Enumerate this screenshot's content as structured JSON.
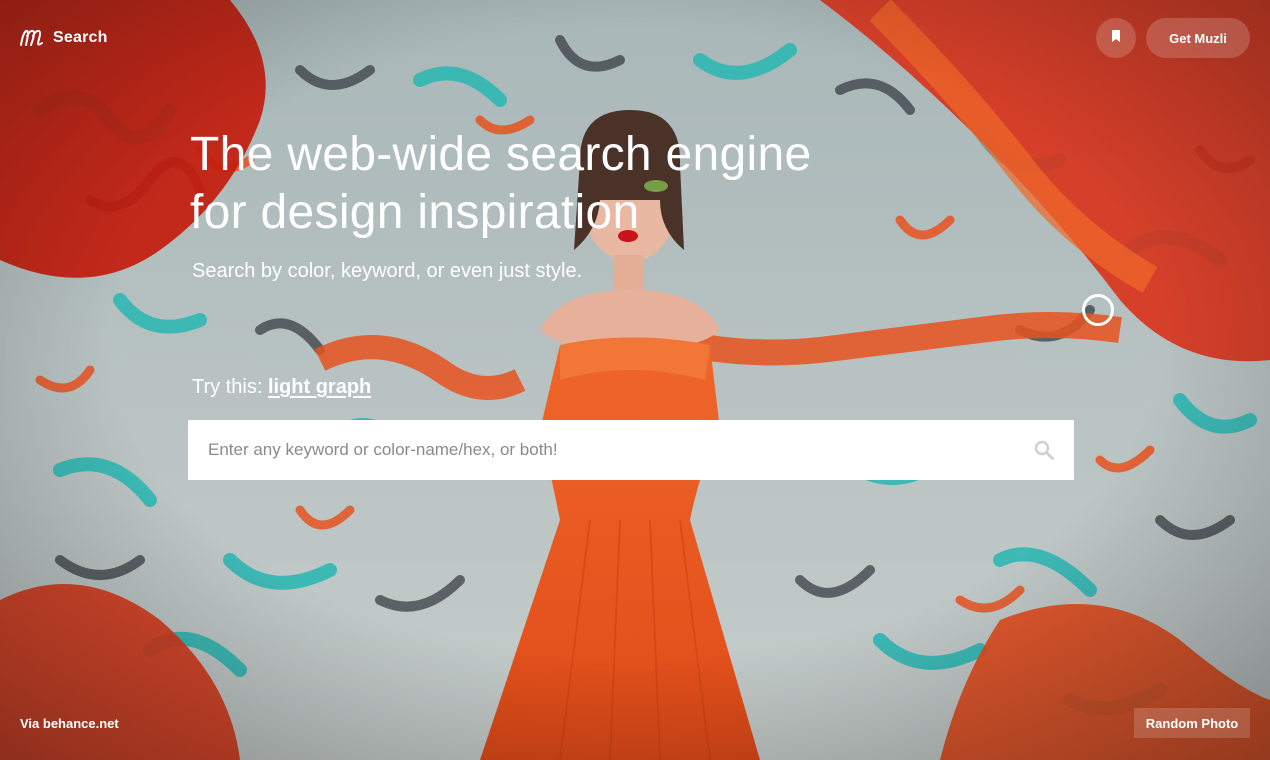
{
  "colors": {
    "accent_orange": "#e8521e",
    "paint_teal": "#2fb8b4",
    "paint_dark": "#3a3f46",
    "wall": "#b9c4c4",
    "text": "#ffffff",
    "search_bg": "#ffffff",
    "placeholder": "#8a8a8a"
  },
  "header": {
    "logo_icon": "muzli-m-logo-icon",
    "title": "Search",
    "bookmark_icon": "bookmark-icon",
    "get_button": "Get Muzli"
  },
  "hero": {
    "title_line1": "The web-wide search engine",
    "title_line2": "for design inspiration",
    "subtitle": "Search by color, keyword, or even just style."
  },
  "try": {
    "label": "Try this:",
    "suggestion": "light graph"
  },
  "search": {
    "value": "",
    "placeholder": "Enter any keyword or color-name/hex, or both!",
    "icon": "search-icon"
  },
  "footer": {
    "source": "Via behance.net",
    "random_button": "Random Photo"
  }
}
